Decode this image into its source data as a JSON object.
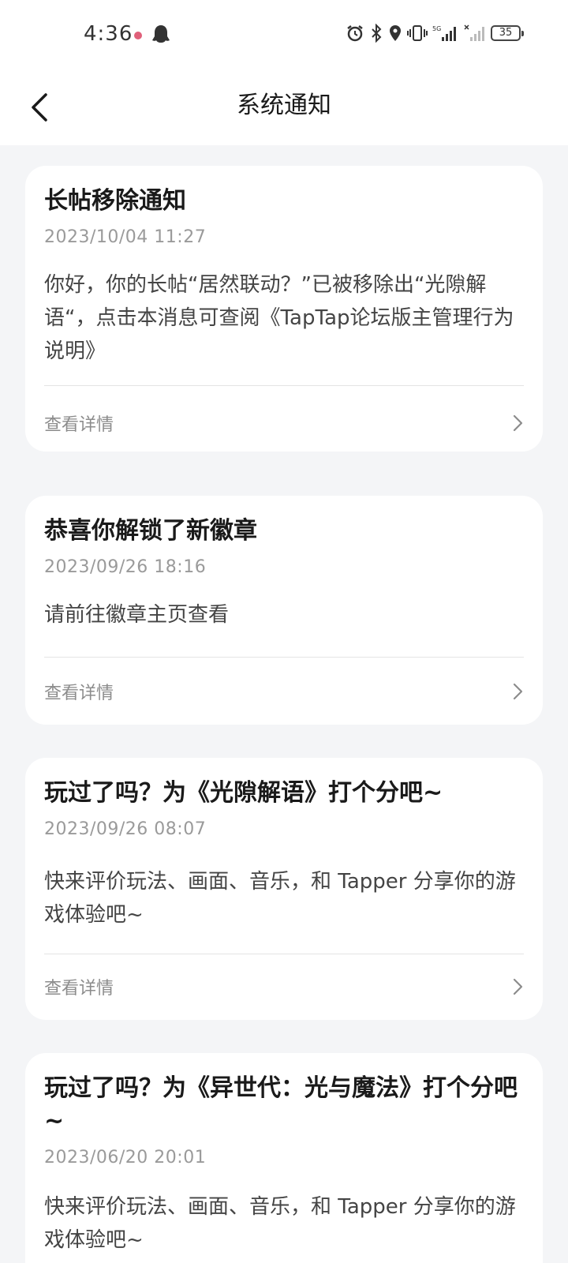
{
  "status_bar": {
    "time": "4:36",
    "battery": "35"
  },
  "header": {
    "title": "系统通知",
    "back_icon": "chevron-left-icon"
  },
  "notifications": [
    {
      "title": "长帖移除通知",
      "time": "2023/10/04 11:27",
      "body": "你好，你的长帖“居然联动？”已被移除出“光隙解语“，点击本消息可查阅《TapTap论坛版主管理行为说明》",
      "action": "查看详情"
    },
    {
      "title": "恭喜你解锁了新徽章",
      "time": "2023/09/26 18:16",
      "body": "请前往徽章主页查看",
      "action": "查看详情"
    },
    {
      "title": "玩过了吗？为《光隙解语》打个分吧~",
      "time": "2023/09/26 08:07",
      "body": "快来评价玩法、画面、音乐，和 Tapper 分享你的游戏体验吧~",
      "action": "查看详情"
    },
    {
      "title": "玩过了吗？为《异世代：光与魔法》打个分吧~",
      "time": "2023/06/20 20:01",
      "body": "快来评价玩法、画面、音乐，和 Tapper 分享你的游戏体验吧~"
    }
  ]
}
